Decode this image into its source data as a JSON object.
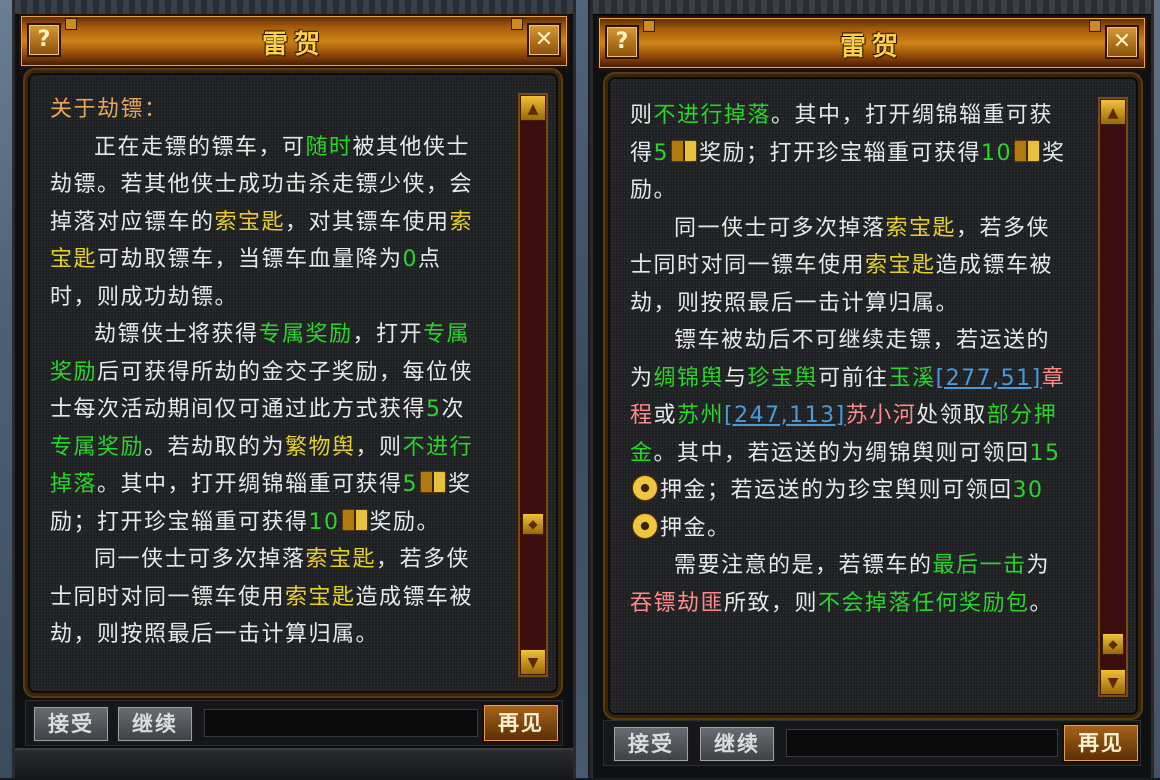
{
  "left": {
    "title": "雷贺",
    "help_symbol": "?",
    "close_symbol": "✕",
    "paragraphs": [
      {
        "cls": "heading",
        "runs": [
          {
            "t": "关于劫镖："
          }
        ]
      },
      {
        "cls": "ind",
        "runs": [
          {
            "t": "正在走镖的镖车，可"
          },
          {
            "t": "随时",
            "c": "g"
          },
          {
            "t": "被其他侠士劫镖。若其他侠士成功击杀走镖少侠，会掉落对应镖车的"
          },
          {
            "t": "索宝匙",
            "c": "y"
          },
          {
            "t": "，对其镖车使用"
          },
          {
            "t": "索宝匙",
            "c": "y"
          },
          {
            "t": "可劫取镖车，当镖车血量降为"
          },
          {
            "t": "0",
            "c": "g"
          },
          {
            "t": "点时，则成功劫镖。"
          }
        ]
      },
      {
        "cls": "ind",
        "runs": [
          {
            "t": "劫镖侠士将获得"
          },
          {
            "t": "专属奖励",
            "c": "g"
          },
          {
            "t": "，打开"
          },
          {
            "t": "专属奖励",
            "c": "g"
          },
          {
            "t": "后可获得所劫的金交子奖励，每位侠士每次活动期间仅可通过此方式获得"
          },
          {
            "t": "5",
            "c": "g"
          },
          {
            "t": "次"
          },
          {
            "t": "专属奖励",
            "c": "g"
          },
          {
            "t": "。若劫取的为"
          },
          {
            "t": "繁物舆",
            "c": "y"
          },
          {
            "t": "，则"
          },
          {
            "t": "不进行掉落",
            "c": "g"
          },
          {
            "t": "。其中，打开绸锦辎重可获得"
          },
          {
            "t": "5",
            "c": "g"
          },
          {
            "icon": "book"
          },
          {
            "t": "奖励；打开珍宝辎重可获得"
          },
          {
            "t": "10",
            "c": "g"
          },
          {
            "icon": "book"
          },
          {
            "t": "奖励。"
          }
        ]
      },
      {
        "cls": "ind",
        "runs": [
          {
            "t": "同一侠士可多次掉落"
          },
          {
            "t": "索宝匙",
            "c": "y"
          },
          {
            "t": "，若多侠士同时对同一镖车使用"
          },
          {
            "t": "索宝匙",
            "c": "y"
          },
          {
            "t": "造成镖车被劫，则按照最后一击计算归属。"
          }
        ]
      }
    ],
    "buttons": {
      "accept": "接受",
      "continue": "继续",
      "goodbye": "再见"
    }
  },
  "right": {
    "title": "雷贺",
    "help_symbol": "?",
    "close_symbol": "✕",
    "paragraphs": [
      {
        "cls": "",
        "runs": [
          {
            "t": "则"
          },
          {
            "t": "不进行掉落",
            "c": "g"
          },
          {
            "t": "。其中，打开绸锦辎重可获得"
          },
          {
            "t": "5",
            "c": "g"
          },
          {
            "icon": "book"
          },
          {
            "t": "奖励；打开珍宝辎重可获得"
          },
          {
            "t": "10",
            "c": "g"
          },
          {
            "icon": "book"
          },
          {
            "t": "奖励。"
          }
        ]
      },
      {
        "cls": "ind",
        "runs": [
          {
            "t": "同一侠士可多次掉落"
          },
          {
            "t": "索宝匙",
            "c": "y"
          },
          {
            "t": "，若多侠士同时对同一镖车使用"
          },
          {
            "t": "索宝匙",
            "c": "y"
          },
          {
            "t": "造成镖车被劫，则按照最后一击计算归属。"
          }
        ]
      },
      {
        "cls": "ind",
        "runs": [
          {
            "t": "镖车被劫后不可继续走镖，若运送的为"
          },
          {
            "t": "绸锦舆",
            "c": "g"
          },
          {
            "t": "与"
          },
          {
            "t": "珍宝舆",
            "c": "g"
          },
          {
            "t": "可前往"
          },
          {
            "t": "玉溪",
            "c": "g"
          },
          {
            "t": "[277,51]",
            "c": "lk"
          },
          {
            "t": "章程",
            "c": "p"
          },
          {
            "t": "或"
          },
          {
            "t": "苏州",
            "c": "g"
          },
          {
            "t": "[247,113]",
            "c": "lk"
          },
          {
            "t": "苏小河",
            "c": "p"
          },
          {
            "t": "处领取"
          },
          {
            "t": "部分押金",
            "c": "g"
          },
          {
            "t": "。其中，若运送的为绸锦舆则可领回"
          },
          {
            "t": "15",
            "c": "g"
          },
          {
            "icon": "coin"
          },
          {
            "t": "押金；若运送的为珍宝舆则可领回"
          },
          {
            "t": "30",
            "c": "g"
          },
          {
            "icon": "coin"
          },
          {
            "t": "押金。"
          }
        ]
      },
      {
        "cls": "ind",
        "runs": [
          {
            "t": "需要注意的是，若镖车的"
          },
          {
            "t": "最后一击",
            "c": "g"
          },
          {
            "t": "为"
          },
          {
            "t": "吞镖劫匪",
            "c": "p"
          },
          {
            "t": "所致，则"
          },
          {
            "t": "不会掉落任何奖励包",
            "c": "g"
          },
          {
            "t": "。"
          }
        ]
      }
    ],
    "buttons": {
      "accept": "接受",
      "continue": "继续",
      "goodbye": "再见"
    }
  },
  "colors": {
    "green": "#2bd42b",
    "yellow": "#e5cf2a",
    "pink": "#ff8a8a",
    "link": "#4a9ad8",
    "title": "#ffd04a"
  },
  "icons": {
    "book": "gold-book-icon",
    "coin": "copper-coin-icon"
  }
}
